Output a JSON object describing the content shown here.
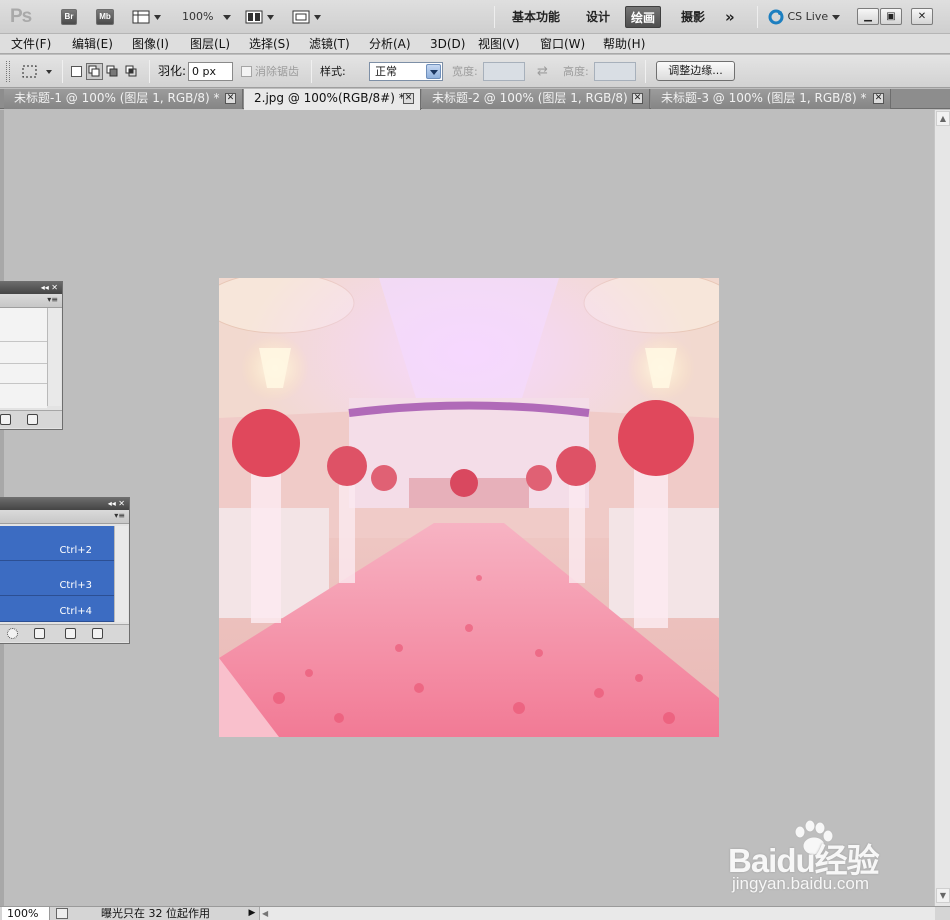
{
  "app": {
    "logo": "Ps",
    "bridge_label": "Br",
    "minibridge_label": "Mb",
    "zoom": "100%",
    "workspaces": [
      "基本功能",
      "设计",
      "绘画",
      "摄影"
    ],
    "active_workspace": "绘画",
    "more_label": "»",
    "cs_live": "CS Live"
  },
  "menu": [
    "文件(F)",
    "编辑(E)",
    "图像(I)",
    "图层(L)",
    "选择(S)",
    "滤镜(T)",
    "分析(A)",
    "3D(D)",
    "视图(V)",
    "窗口(W)",
    "帮助(H)"
  ],
  "options": {
    "feather_label": "羽化:",
    "feather_value": "0 px",
    "antialias_label": "消除锯齿",
    "style_label": "样式:",
    "style_value": "正常",
    "width_label": "宽度:",
    "height_label": "高度:",
    "refine_edge": "调整边缘..."
  },
  "tabs": [
    {
      "title": "未标题-1 @ 100% (图层 1, RGB/8) *",
      "active": false
    },
    {
      "title": "2.jpg @ 100%(RGB/8#) *",
      "active": true
    },
    {
      "title": "未标题-2 @ 100% (图层 1, RGB/8)",
      "active": false
    },
    {
      "title": "未标题-3 @ 100% (图层 1, RGB/8) *",
      "active": false
    }
  ],
  "channels_panel": {
    "rows": [
      {
        "shortcut": "Ctrl+2"
      },
      {
        "shortcut": "Ctrl+3"
      },
      {
        "shortcut": "Ctrl+4"
      }
    ]
  },
  "status": {
    "zoom": "100%",
    "info": "曝光只在 32 位起作用"
  },
  "watermark": {
    "brand": "Baidu经验",
    "url": "jingyan.baidu.com"
  },
  "colors": {
    "accent": "#3c6cc2",
    "canvas_bg": "#bebebe",
    "active_ws": "#5a5a5a"
  }
}
